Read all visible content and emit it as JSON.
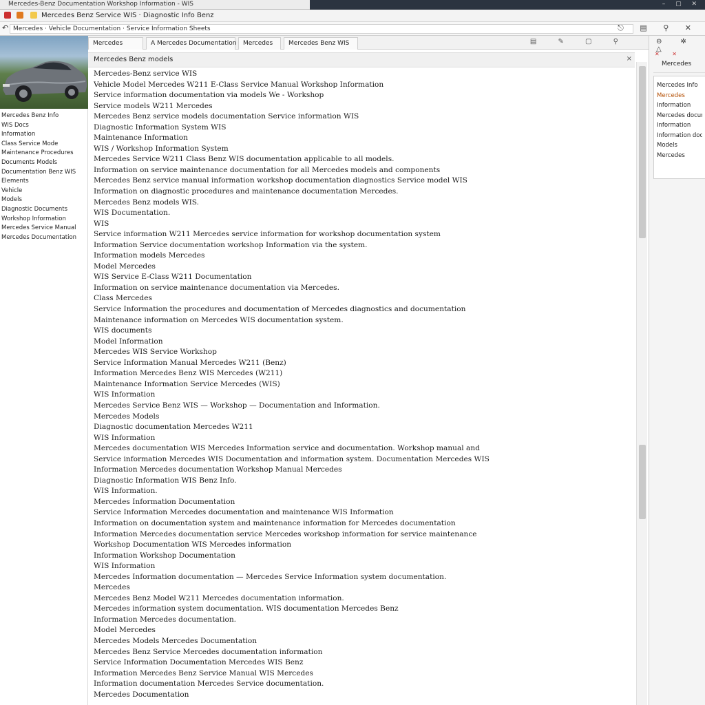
{
  "window": {
    "title": "Mercedes-Benz Documentation Workshop Information - WIS",
    "controls": "– ▢ ✕"
  },
  "menubar": {
    "title": "Mercedes Benz Service WIS · Diagnostic Info Benz"
  },
  "address": {
    "url": "Mercedes · Vehicle Documentation · Service Information Sheets",
    "back": "↶",
    "tools": "⎋ ▤ ⚲ ✕"
  },
  "tabs": [
    {
      "label": "Mercedes"
    },
    {
      "label": "A Mercedes Documentation"
    },
    {
      "label": "Mercedes"
    },
    {
      "label": "Mercedes Benz WIS"
    }
  ],
  "tab_tools": "▤ ✎ ▢ ⚲",
  "left": {
    "items": [
      "Mercedes Benz Info",
      "WIS Docs",
      "Information",
      "Class Service Mode",
      "Maintenance Procedures",
      "Documents Models",
      "Documentation Benz WIS",
      "Elements",
      "Vehicle",
      "Models",
      "Diagnostic Documents",
      "Workshop Information",
      "Mercedes Service Manual",
      "Mercedes Documentation"
    ]
  },
  "doc": {
    "header": "Mercedes Benz models",
    "close": "×",
    "lines": [
      "Mercedes-Benz service WIS",
      "Vehicle Model Mercedes W211 E-Class Service Manual Workshop Information",
      "Service information documentation via models We - Workshop",
      "Service models W211 Mercedes",
      "Mercedes Benz service models documentation Service information WIS",
      "Diagnostic Information System WIS",
      "",
      "Maintenance Information",
      "WIS / Workshop Information System",
      "Mercedes Service W211 Class Benz WIS documentation applicable to all models.",
      "Information on service maintenance documentation for all Mercedes models and components",
      "Mercedes Benz service manual information workshop documentation diagnostics Service model WIS",
      "Information on diagnostic procedures and maintenance documentation Mercedes.",
      "Mercedes Benz models WIS.",
      "WIS Documentation.",
      "WIS",
      "Service information W211 Mercedes service information for workshop documentation system",
      "Information Service documentation workshop Information via the system.",
      "Information models Mercedes",
      "",
      "Model Mercedes",
      "WIS Service E-Class W211 Documentation",
      "Information on service maintenance documentation via Mercedes.",
      "Class Mercedes",
      "Service Information the procedures and documentation of Mercedes diagnostics and documentation",
      "Maintenance information on Mercedes WIS documentation system.",
      "WIS documents",
      "Model Information",
      "Mercedes WIS Service Workshop",
      "Service Information Manual Mercedes W211 (Benz)",
      "Information Mercedes Benz WIS Mercedes (W211)",
      "Maintenance Information Service Mercedes (WIS)",
      "WIS Information",
      "Mercedes Service Benz WIS — Workshop — Documentation and Information.",
      "Mercedes Models",
      "",
      "Diagnostic documentation Mercedes W211",
      "WIS Information",
      "Mercedes documentation WIS Mercedes Information service and documentation. Workshop manual and",
      "Service information Mercedes WIS Documentation and information system. Documentation Mercedes WIS",
      "Information Mercedes documentation Workshop Manual Mercedes",
      "Diagnostic Information WIS Benz Info.",
      "WIS Information.",
      "Mercedes Information Documentation",
      "Service Information Mercedes documentation and maintenance WIS Information",
      "Information on documentation system and maintenance information for Mercedes documentation",
      "Information Mercedes documentation service Mercedes workshop information for service maintenance",
      "Workshop Documentation WIS Mercedes information",
      "Information Workshop Documentation",
      "WIS Information",
      "Mercedes Information documentation — Mercedes Service Information system documentation.",
      "Mercedes",
      "Mercedes Benz Model W211 Mercedes documentation information.",
      "Mercedes information system documentation. WIS documentation Mercedes Benz",
      "Information Mercedes documentation.",
      "Model Mercedes",
      "Mercedes Models Mercedes Documentation",
      "Mercedes Benz Service Mercedes documentation information",
      "Service Information Documentation Mercedes WIS Benz",
      "Information Mercedes Benz Service Manual WIS Mercedes",
      "Information documentation Mercedes Service documentation.",
      "Mercedes Documentation"
    ]
  },
  "right": {
    "tools": "⊖ ✲ △",
    "head_marks": "✕ ✕",
    "head_title": "Mercedes",
    "card": [
      "Mercedes Info",
      "Mercedes",
      "Information",
      "Mercedes documentation",
      "Information",
      "Information documentation",
      "Models",
      "Mercedes"
    ]
  },
  "colors": {
    "titlebar_dark": "#2b3440",
    "accent_red": "#cc2f2f",
    "accent_orange": "#e07a1f"
  }
}
